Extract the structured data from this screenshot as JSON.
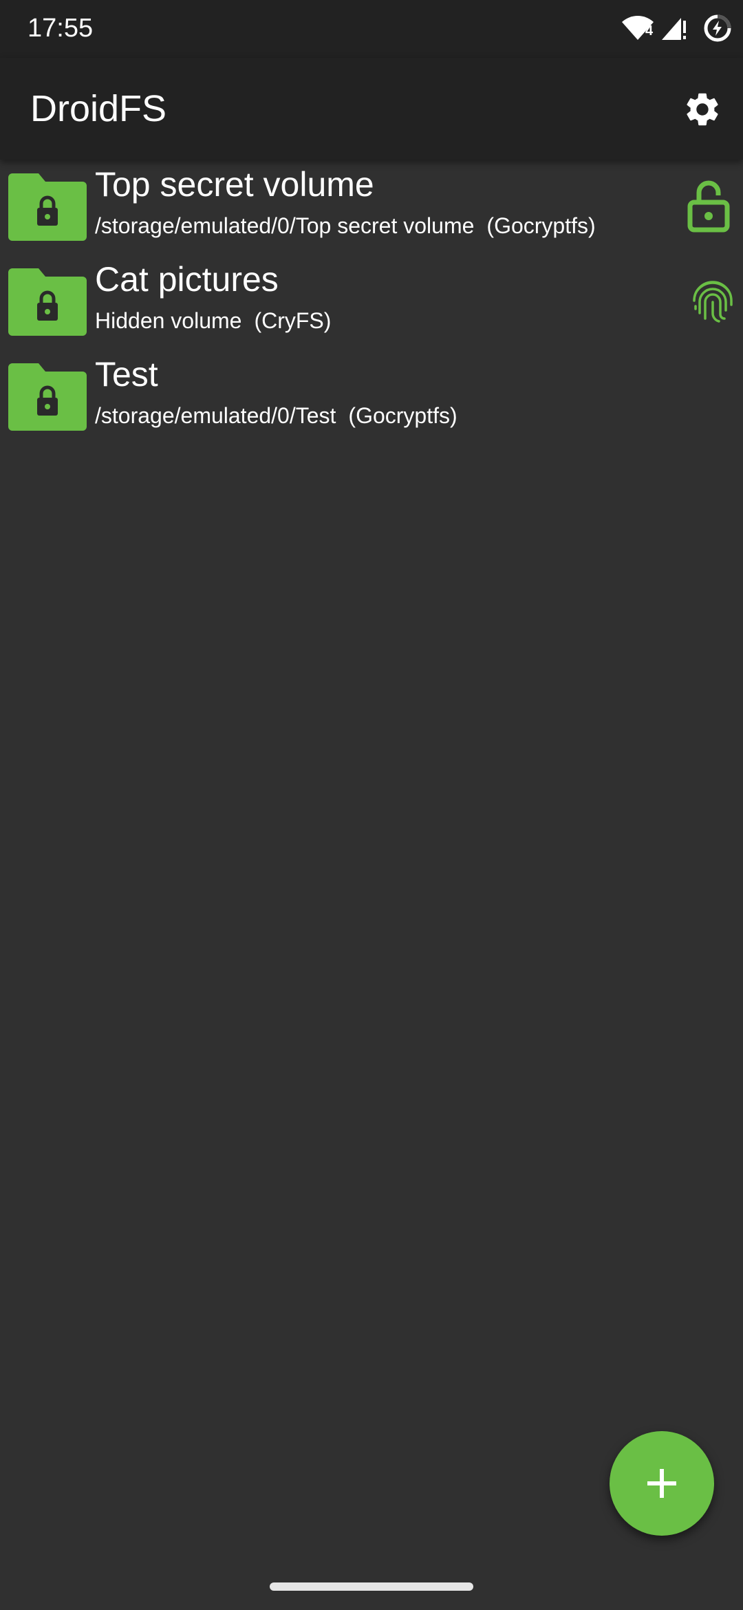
{
  "status_bar": {
    "time": "17:55",
    "icons": [
      "wifi-icon",
      "signal-icon",
      "data-saver-icon"
    ],
    "wifi_badge": "4"
  },
  "app_bar": {
    "title": "DroidFS",
    "settings_icon": "gear-icon"
  },
  "colors": {
    "accent": "#6abf45",
    "background": "#303030",
    "toolbar": "#222222"
  },
  "volumes": [
    {
      "name": "Top secret volume",
      "path": "/storage/emulated/0/Top secret volume",
      "type": "(Gocryptfs)",
      "icon": "locked-folder-icon",
      "trailing_icon": "unlocked-padlock-icon"
    },
    {
      "name": "Cat pictures",
      "path": "Hidden volume",
      "type": "(CryFS)",
      "icon": "locked-folder-icon",
      "trailing_icon": "fingerprint-icon"
    },
    {
      "name": "Test",
      "path": "/storage/emulated/0/Test",
      "type": "(Gocryptfs)",
      "icon": "locked-folder-icon",
      "trailing_icon": ""
    }
  ],
  "fab": {
    "icon": "plus-icon"
  }
}
